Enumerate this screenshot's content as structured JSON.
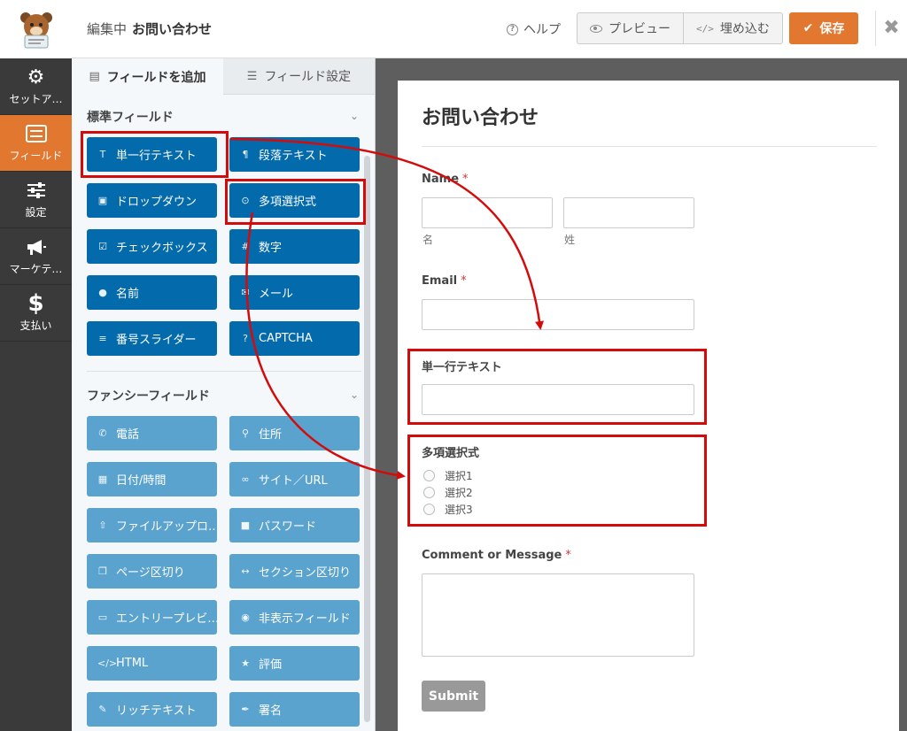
{
  "header": {
    "editing_label": "編集中",
    "form_name": "お問い合わせ",
    "help_label": "ヘルプ",
    "preview_label": "プレビュー",
    "embed_label": "埋め込む",
    "save_label": "保存",
    "close_label": "✖",
    "accent_color": "#e27730"
  },
  "sidebar": {
    "items": [
      {
        "label": "セットア…",
        "icon": "gear-icon"
      },
      {
        "label": "フィールド",
        "icon": "fields-icon",
        "active": true
      },
      {
        "label": "設定",
        "icon": "sliders-icon"
      },
      {
        "label": "マーケテ…",
        "icon": "megaphone-icon"
      },
      {
        "label": "支払い",
        "icon": "dollar-icon"
      }
    ]
  },
  "panel": {
    "tabs": [
      {
        "label": "フィールドを追加",
        "icon": "list-icon",
        "active": true
      },
      {
        "label": "フィールド設定",
        "icon": "sliders-icon"
      }
    ],
    "standard_title": "標準フィールド",
    "fancy_title": "ファンシーフィールド",
    "standard_fields": [
      {
        "label": "単一行テキスト",
        "icon": "text-icon"
      },
      {
        "label": "段落テキスト",
        "icon": "paragraph-icon"
      },
      {
        "label": "ドロップダウン",
        "icon": "dropdown-icon"
      },
      {
        "label": "多項選択式",
        "icon": "radio-icon"
      },
      {
        "label": "チェックボックス",
        "icon": "checkbox-icon"
      },
      {
        "label": "数字",
        "icon": "hash-icon"
      },
      {
        "label": "名前",
        "icon": "user-icon"
      },
      {
        "label": "メール",
        "icon": "envelope-icon"
      },
      {
        "label": "番号スライダー",
        "icon": "slider-icon"
      },
      {
        "label": "CAPTCHA",
        "icon": "question-icon"
      }
    ],
    "fancy_fields": [
      {
        "label": "電話",
        "icon": "phone-icon"
      },
      {
        "label": "住所",
        "icon": "map-pin-icon"
      },
      {
        "label": "日付/時間",
        "icon": "calendar-icon"
      },
      {
        "label": "サイト／URL",
        "icon": "link-icon"
      },
      {
        "label": "ファイルアップロ…",
        "icon": "upload-icon"
      },
      {
        "label": "パスワード",
        "icon": "lock-icon"
      },
      {
        "label": "ページ区切り",
        "icon": "pages-icon"
      },
      {
        "label": "セクション区切り",
        "icon": "arrows-h-icon"
      },
      {
        "label": "エントリープレビ…",
        "icon": "file-icon"
      },
      {
        "label": "非表示フィールド",
        "icon": "eye-slash-icon"
      },
      {
        "label": "HTML",
        "icon": "code-icon"
      },
      {
        "label": "評価",
        "icon": "star-icon"
      },
      {
        "label": "リッチテキスト",
        "icon": "edit-icon"
      },
      {
        "label": "署名",
        "icon": "pen-icon"
      }
    ]
  },
  "form": {
    "title": "お問い合わせ",
    "name_label": "Name",
    "first_sublabel": "名",
    "last_sublabel": "姓",
    "email_label": "Email",
    "single_line_label": "単一行テキスト",
    "multiple_choice_label": "多項選択式",
    "choices": [
      "選択1",
      "選択2",
      "選択3"
    ],
    "comment_label": "Comment or Message",
    "required_mark": "*",
    "submit_label": "Submit"
  }
}
